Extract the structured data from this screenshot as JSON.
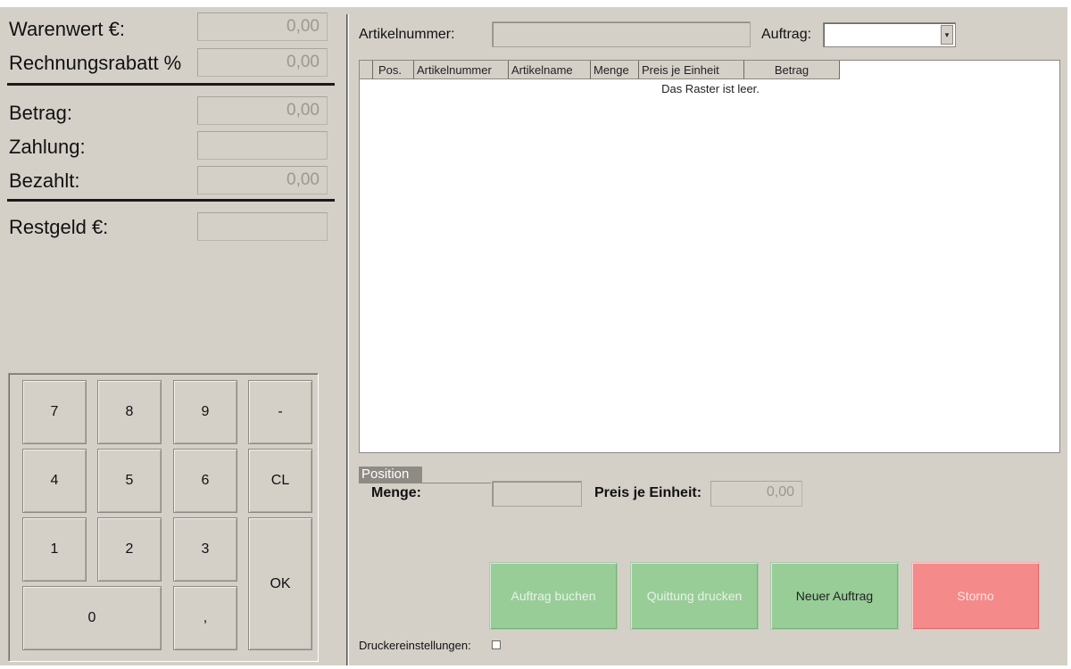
{
  "summary": {
    "warenwert_label": "Warenwert €:",
    "warenwert_value": "0,00",
    "rabatt_label": "Rechnungsrabatt %",
    "rabatt_value": "0,00",
    "betrag_label": "Betrag:",
    "betrag_value": "0,00",
    "zahlung_label": "Zahlung:",
    "zahlung_value": "",
    "bezahlt_label": "Bezahlt:",
    "bezahlt_value": "0,00",
    "restgeld_label": "Restgeld €:",
    "restgeld_value": ""
  },
  "keypad": {
    "k7": "7",
    "k8": "8",
    "k9": "9",
    "minus": "-",
    "k4": "4",
    "k5": "5",
    "k6": "6",
    "cl": "CL",
    "k1": "1",
    "k2": "2",
    "k3": "3",
    "ok": "OK",
    "k0": "0",
    "comma": ","
  },
  "order": {
    "artikelnummer_label": "Artikelnummer:",
    "artikelnummer_value": "",
    "auftrag_label": "Auftrag:",
    "auftrag_value": ""
  },
  "grid": {
    "columns": [
      "Pos.",
      "Artikelnummer",
      "Artikelname",
      "Menge",
      "Preis je Einheit",
      "Betrag"
    ],
    "empty_text": "Das Raster ist leer."
  },
  "position": {
    "title": "Position",
    "menge_label": "Menge:",
    "menge_value": "",
    "preis_label": "Preis je Einheit:",
    "preis_value": "0,00"
  },
  "actions": {
    "auftrag_buchen": "Auftrag buchen",
    "quittung_drucken": "Quittung drucken",
    "neuer_auftrag": "Neuer Auftrag",
    "storno": "Storno"
  },
  "footer": {
    "drucker_label": "Druckereinstellungen:"
  },
  "colors": {
    "background": "#d4d0c8",
    "button_green": "#98cd97",
    "button_red": "#f58a8a"
  }
}
